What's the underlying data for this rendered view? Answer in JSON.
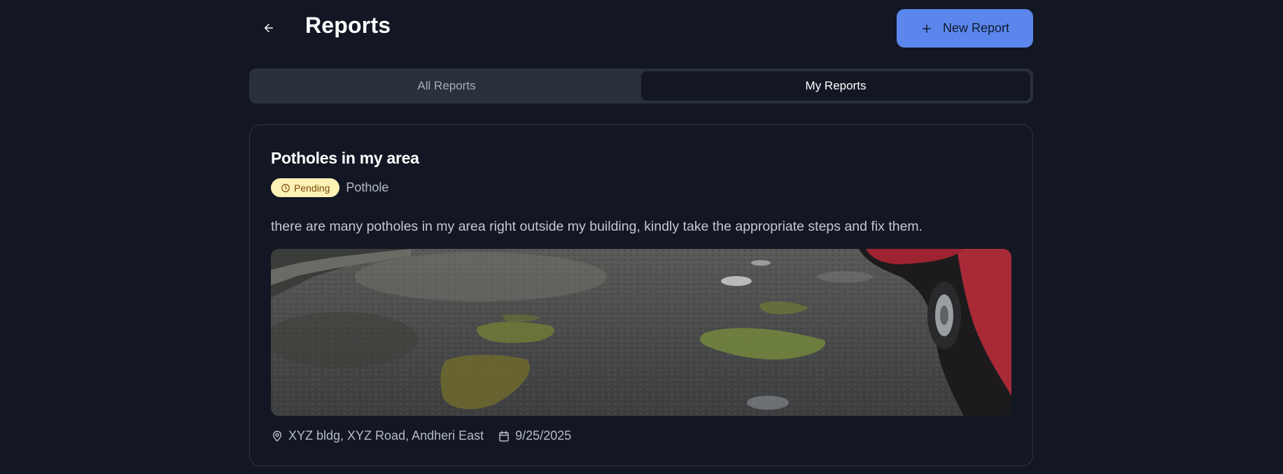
{
  "header": {
    "title": "Reports",
    "new_report_label": "New Report"
  },
  "tabs": [
    {
      "label": "All Reports",
      "active": false
    },
    {
      "label": "My Reports",
      "active": true
    }
  ],
  "report": {
    "title": "Potholes in my area",
    "status": "Pending",
    "category": "Pothole",
    "description": "there are many potholes in my area right outside my building, kindly take the appropriate steps and fix them.",
    "location": "XYZ bldg, XYZ Road, Andheri East",
    "date": "9/25/2025",
    "photo_subject": "wet asphalt road with water-filled potholes and a parked red car"
  },
  "colors": {
    "background": "#121723",
    "primary": "#5b87ec",
    "tab_track": "#2a303c",
    "pending_badge_bg": "#fdf2b5",
    "pending_badge_text": "#7a4a09"
  },
  "icons": {
    "back": "arrow-left-icon",
    "new_report": "plus-icon",
    "status": "clock-icon",
    "location": "map-pin-icon",
    "date": "calendar-icon"
  }
}
